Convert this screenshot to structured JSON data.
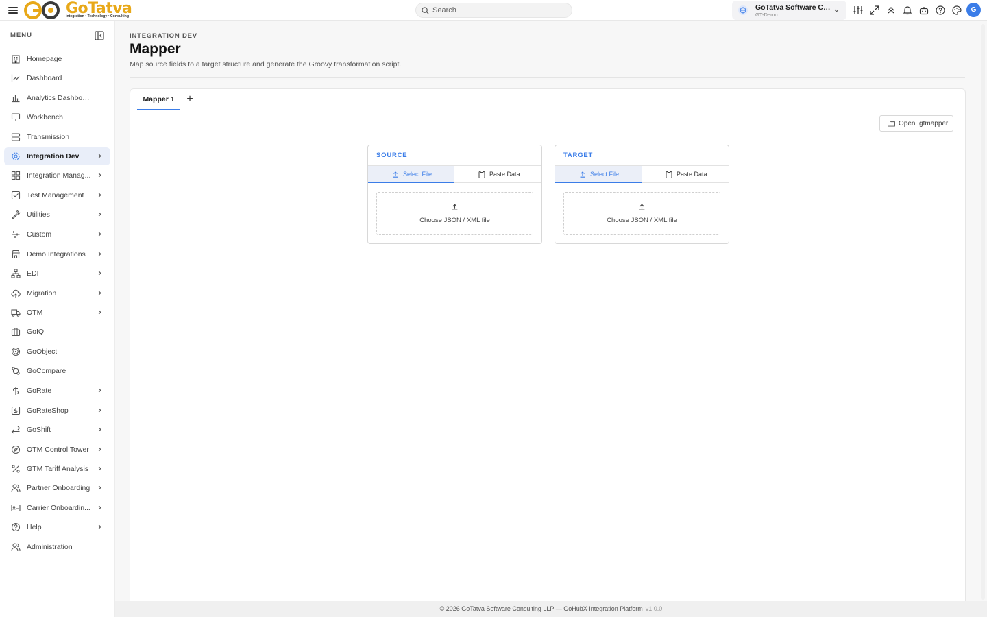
{
  "header": {
    "logo_text": "GoTatva",
    "logo_tagline": "Integration • Technology • Consulting",
    "search_placeholder": "Search",
    "org_name": "GoTatva Software Co...",
    "org_sub": "GT-Demo",
    "avatar_initial": "G",
    "accent_color": "#3b7de8",
    "brand_color": "#e8a818"
  },
  "sidebar": {
    "title": "MENU",
    "items": [
      {
        "label": "Homepage",
        "icon": "building-icon",
        "chevron": false
      },
      {
        "label": "Dashboard",
        "icon": "line-chart-icon",
        "chevron": false
      },
      {
        "label": "Analytics Dashboard",
        "icon": "bar-chart-icon",
        "chevron": false
      },
      {
        "label": "Workbench",
        "icon": "monitor-icon",
        "chevron": false
      },
      {
        "label": "Transmission",
        "icon": "server-icon",
        "chevron": false
      },
      {
        "label": "Integration Dev",
        "icon": "gear-icon",
        "chevron": true,
        "active": true
      },
      {
        "label": "Integration Manag...",
        "icon": "grid-icon",
        "chevron": true
      },
      {
        "label": "Test Management",
        "icon": "check-square-icon",
        "chevron": true
      },
      {
        "label": "Utilities",
        "icon": "wrench-icon",
        "chevron": true
      },
      {
        "label": "Custom",
        "icon": "sliders-icon",
        "chevron": true
      },
      {
        "label": "Demo Integrations",
        "icon": "store-icon",
        "chevron": true
      },
      {
        "label": "EDI",
        "icon": "network-icon",
        "chevron": true
      },
      {
        "label": "Migration",
        "icon": "cloud-upload-icon",
        "chevron": true
      },
      {
        "label": "OTM",
        "icon": "truck-icon",
        "chevron": true
      },
      {
        "label": "GoIQ",
        "icon": "briefcase-icon",
        "chevron": false
      },
      {
        "label": "GoObject",
        "icon": "target-icon",
        "chevron": false
      },
      {
        "label": "GoCompare",
        "icon": "git-compare-icon",
        "chevron": false
      },
      {
        "label": "GoRate",
        "icon": "dollar-icon",
        "chevron": true
      },
      {
        "label": "GoRateShop",
        "icon": "dollar-square-icon",
        "chevron": true
      },
      {
        "label": "GoShift",
        "icon": "arrows-exchange-icon",
        "chevron": true
      },
      {
        "label": "OTM Control Tower",
        "icon": "compass-icon",
        "chevron": true
      },
      {
        "label": "GTM Tariff Analysis",
        "icon": "percent-icon",
        "chevron": true
      },
      {
        "label": "Partner Onboarding",
        "icon": "users-icon",
        "chevron": true
      },
      {
        "label": "Carrier Onboardin...",
        "icon": "id-card-icon",
        "chevron": true
      },
      {
        "label": "Help",
        "icon": "help-circle-icon",
        "chevron": true
      },
      {
        "label": "Administration",
        "icon": "users-icon",
        "chevron": false
      }
    ]
  },
  "main": {
    "eyebrow": "INTEGRATION DEV",
    "title": "Mapper",
    "description": "Map source fields to a target structure and generate the Groovy transformation script.",
    "tabs": [
      {
        "label": "Mapper 1"
      }
    ],
    "add_tab": "+",
    "open_button": "Open .gtmapper",
    "source": {
      "title": "SOURCE",
      "select_file": "Select File",
      "paste_data": "Paste Data",
      "dropzone": "Choose JSON / XML file"
    },
    "target": {
      "title": "TARGET",
      "select_file": "Select File",
      "paste_data": "Paste Data",
      "dropzone": "Choose JSON / XML file"
    }
  },
  "footer": {
    "text": "© 2026 GoTatva Software Consulting LLP — GoHubX Integration Platform",
    "version": "v1.0.0"
  }
}
